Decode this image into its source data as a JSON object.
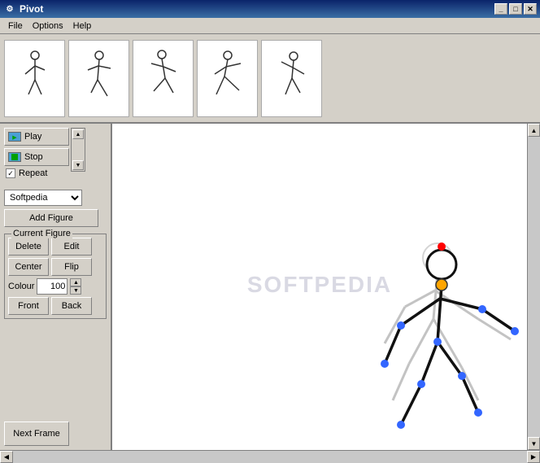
{
  "title": "Pivot",
  "menu": {
    "file": "File",
    "options": "Options",
    "help": "Help"
  },
  "controls": {
    "play_label": "Play",
    "stop_label": "Stop",
    "repeat_label": "Repeat",
    "dropdown_value": "Softpedia",
    "add_figure_label": "Add Figure",
    "current_figure_label": "Current Figure",
    "delete_label": "Delete",
    "edit_label": "Edit",
    "center_label": "Center",
    "flip_label": "Flip",
    "colour_label": "Colour",
    "colour_value": "100",
    "front_label": "Front",
    "back_label": "Back",
    "next_frame_label": "Next Frame"
  },
  "window_controls": {
    "minimize": "_",
    "maximize": "□",
    "close": "✕"
  },
  "watermark": "SOFTPEDIA"
}
